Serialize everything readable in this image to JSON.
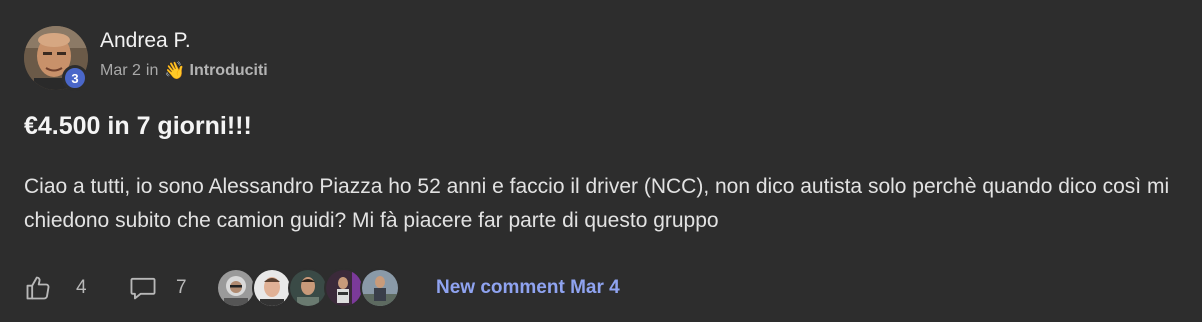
{
  "post": {
    "author": "Andrea P.",
    "level": "3",
    "date": "Mar 2",
    "in_word": "in",
    "category_emoji": "👋",
    "category": "Introduciti",
    "title": "€4.500 in 7 giorni!!!",
    "body": "Ciao a tutti, io sono Alessandro Piazza ho 52 anni e faccio il driver (NCC), non dico autista solo perchè quando dico così mi chiedono subito che camion guidi? Mi fà piacere far parte di questo gruppo"
  },
  "footer": {
    "like_icon": "thumbs-up-icon",
    "likes": "4",
    "comment_icon": "comment-icon",
    "comments": "7",
    "commenter_avatars": [
      "commenter-1",
      "commenter-2",
      "commenter-3",
      "commenter-4",
      "commenter-5"
    ],
    "new_comment_label": "New comment Mar 4"
  },
  "colors": {
    "background": "#2d2d2d",
    "badge": "#4a67c9",
    "link": "#8fa3f0"
  }
}
